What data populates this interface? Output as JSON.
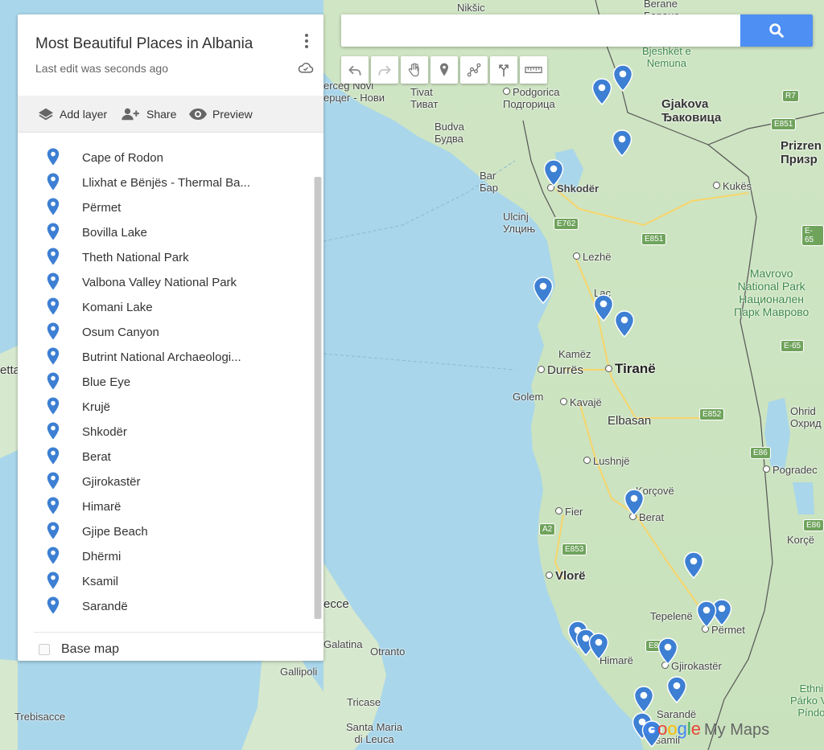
{
  "panel": {
    "title": "Most Beautiful Places in Albania",
    "subtitle": "Last edit was seconds ago",
    "actions": {
      "add_layer": "Add layer",
      "share": "Share",
      "preview": "Preview"
    },
    "items": [
      "Cape of Rodon",
      "Llixhat e Bënjës - Thermal Ba...",
      "Përmet",
      "Bovilla Lake",
      "Theth National Park",
      "Valbona Valley National Park",
      "Komani Lake",
      "Osum Canyon",
      "Butrint National Archaeologi...",
      "Blue Eye",
      "Krujë",
      "Shkodër",
      "Berat",
      "Gjirokastër",
      "Himarë",
      "Gjipe Beach",
      "Dhërmi",
      "Ksamil",
      "Sarandë"
    ],
    "basemap": "Base map"
  },
  "search": {
    "placeholder": ""
  },
  "toolbar": [
    "undo-icon",
    "redo-icon",
    "hand-icon",
    "marker-icon",
    "draw-line-icon",
    "directions-icon",
    "ruler-icon"
  ],
  "colors": {
    "pin": "#3d7fd3",
    "sea": "#a9d6ea",
    "land": "#cfe5c4",
    "search_button": "#4d8ff3"
  },
  "map_labels": {
    "niksic": "Nikšic",
    "berane": "Berane\nБеране",
    "kombetar": "Kombetar\nBjeshkët e\nNemuna",
    "podgorica": "Podgorica\nПодгорица",
    "tivat": "Tivat\nТиват",
    "herceg": "erceg Novi\nерцег - Нови",
    "budva": "Budva\nБудва",
    "gjakova": "Gjakova\nЂаковица",
    "prizren": "Prizren\nПризр",
    "bar": "Bar\nБар",
    "kukes": "Kukës",
    "shkoder": "Shkodër",
    "ulcinj": "Ulcinj\nУлцињ",
    "lezhe": "Lezhë",
    "mavrovo": "Mavrovo\nNational Park\nНационален\nПарк Маврово",
    "lac": "Laç",
    "kamez": "Kamëz",
    "durres": "Durrës",
    "tirane": "Tiranë",
    "golem": "Golem",
    "kavaje": "Kavajë",
    "elbasan": "Elbasan",
    "ohrid": "Ohrid\nОхрид",
    "pogradec": "Pogradec",
    "lushnje": "Lushnjë",
    "korce_top": "Korçovë",
    "berat": "Berat",
    "fier": "Fier",
    "vlore": "Vlorë",
    "korce": "Korçë",
    "tepelene": "Tepelenë",
    "permet": "Përmet",
    "lecce": "ecce",
    "galatina": "Galatina",
    "otranto": "Otranto",
    "gallipoli": "Gallipoli",
    "himare": "Himarë",
    "gjirokaster": "Gjirokastër",
    "ethni": "Ethni\nPárko Vo\nPíndo",
    "tricase": "Tricase",
    "sarande": "Sarandë",
    "trebisacce": "Trebisacce",
    "santa_maria": "Santa Maria\ndi Leuca",
    "ksamil": "Ksamil",
    "etta": "etta"
  },
  "road_shields": [
    "R7",
    "E851",
    "E762",
    "E851",
    "E-65",
    "E-65",
    "E852",
    "E86",
    "E86",
    "A2",
    "E853",
    "E8"
  ],
  "branding": {
    "google": "Google",
    "mymaps": "My Maps"
  }
}
